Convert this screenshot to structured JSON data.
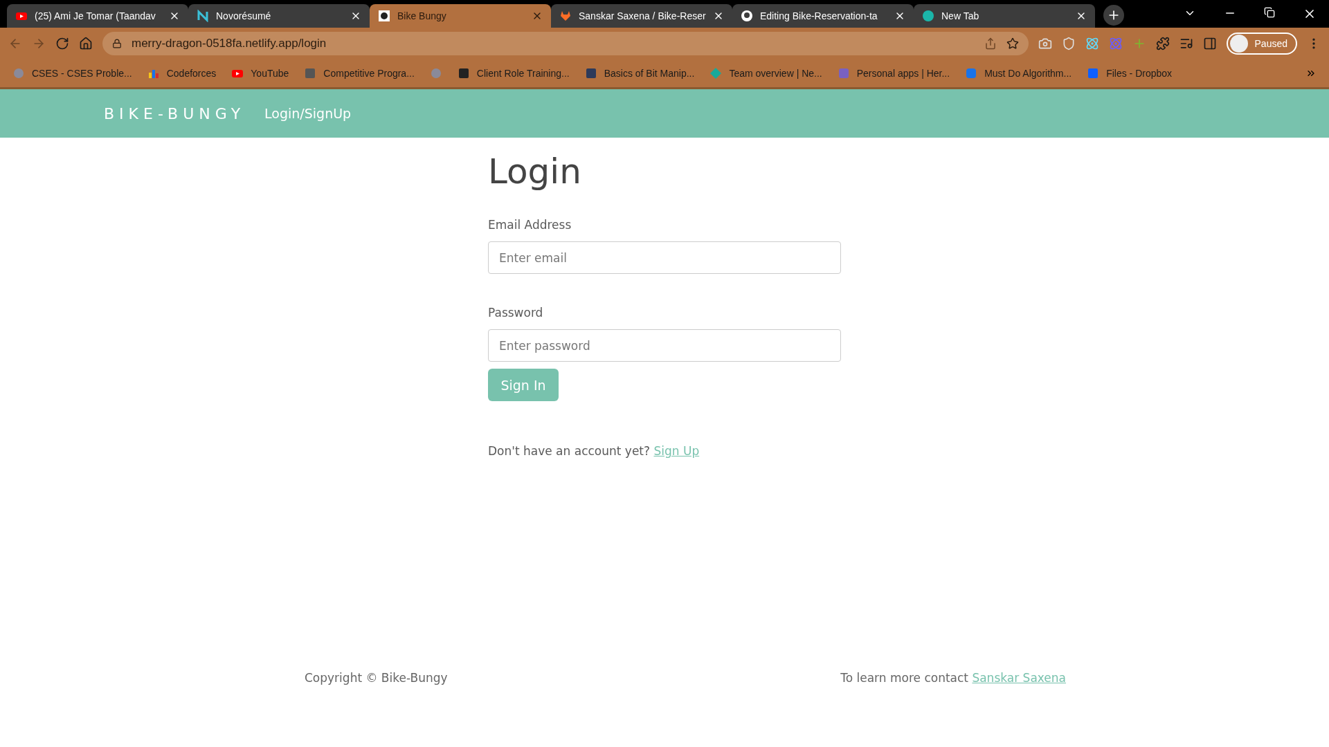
{
  "tabs": [
    {
      "title": "(25) Ami Je Tomar (Taandav",
      "kind": "youtube",
      "selected": false
    },
    {
      "title": "Novorésumé",
      "kind": "novo",
      "selected": false
    },
    {
      "title": "Bike Bungy",
      "kind": "bike",
      "selected": true
    },
    {
      "title": "Sanskar Saxena / Bike-Reser",
      "kind": "gitlab",
      "selected": false
    },
    {
      "title": "Editing Bike-Reservation-ta",
      "kind": "github",
      "selected": false
    },
    {
      "title": "New Tab",
      "kind": "m",
      "selected": false
    }
  ],
  "address": "merry-dragon-0518fa.netlify.app/login",
  "profile": {
    "label": "Paused"
  },
  "bookmarks": [
    {
      "title": "CSES - CSES Proble...",
      "kind": "globe"
    },
    {
      "title": "Codeforces",
      "kind": "bars"
    },
    {
      "title": "YouTube",
      "kind": "youtube"
    },
    {
      "title": "Competitive Progra...",
      "kind": "cc"
    },
    {
      "kind": "globe"
    },
    {
      "title": "Client Role Training...",
      "kind": "trello"
    },
    {
      "title": "Basics of Bit Manip...",
      "kind": "h"
    },
    {
      "title": "Team overview | Ne...",
      "kind": "diamond"
    },
    {
      "title": "Personal apps | Her...",
      "kind": "heroku"
    },
    {
      "title": "Must Do Algorithm...",
      "kind": "infinity"
    },
    {
      "title": "Files - Dropbox",
      "kind": "dropbox"
    }
  ],
  "navbar": {
    "brand": "BIKE-BUNGY",
    "links": [
      "Login/SignUp"
    ]
  },
  "form": {
    "title": "Login",
    "fields": [
      {
        "label": "Email Address",
        "placeholder": "Enter email"
      },
      {
        "label": "Password",
        "placeholder": "Enter password"
      }
    ],
    "submit": "Sign In",
    "prompt": "Don't have an account yet?",
    "prompt_link": "Sign Up"
  },
  "footer": {
    "copyright": "Copyright © Bike-Bungy",
    "contact": "To learn more contact",
    "contact_link": "Sanskar Saxena"
  }
}
